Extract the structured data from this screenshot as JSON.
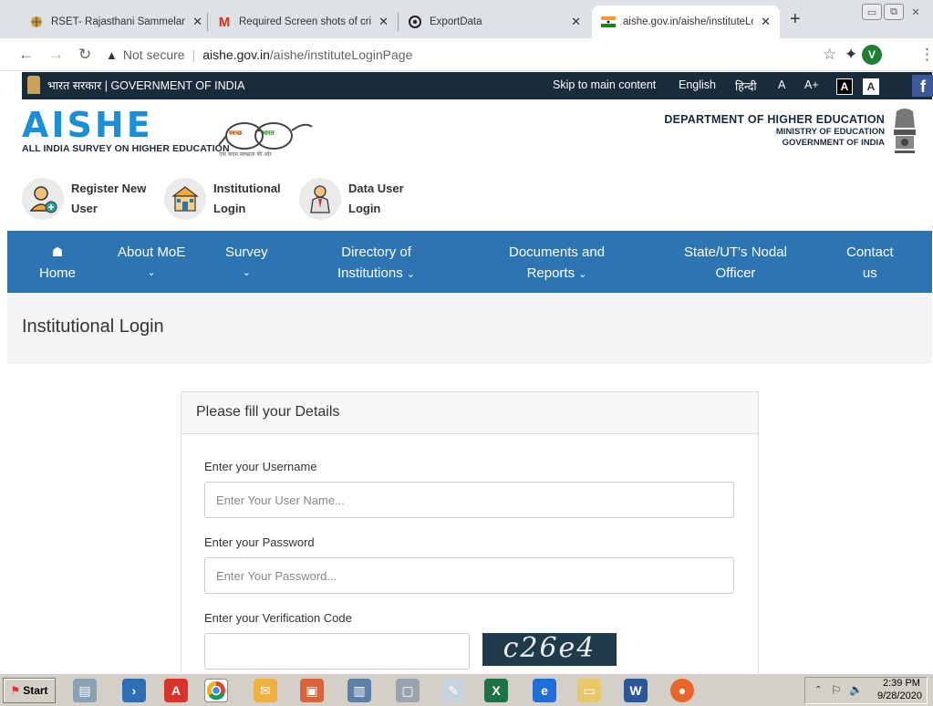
{
  "browser": {
    "tabs": [
      {
        "title": "RSET- Rajasthani Sammelan |",
        "icon": "rset-favicon",
        "active": false
      },
      {
        "title": "Required Screen shots of criti",
        "icon": "gmail-icon",
        "active": false
      },
      {
        "title": "ExportData",
        "icon": "export-icon",
        "active": false
      },
      {
        "title": "aishe.gov.in/aishe/instituteLo",
        "icon": "india-flag-icon",
        "active": true
      }
    ],
    "address": {
      "security": "Not secure",
      "host": "aishe.gov.in",
      "path": "/aishe/instituteLoginPage"
    },
    "profile_initial": "V"
  },
  "govbar": {
    "label": "भारत सरकार | GOVERNMENT OF INDIA",
    "skip": "Skip to main content",
    "english": "English",
    "hindi": "हिन्दी",
    "font_a": "A",
    "font_a_plus": "A+",
    "contrast_dark": "A",
    "contrast_light": "A",
    "facebook": "f"
  },
  "header": {
    "logo": "AISHE",
    "logo_sub": "ALL INDIA SURVEY ON HIGHER EDUCATION",
    "dept_line1": "DEPARTMENT OF HIGHER EDUCATION",
    "dept_line2": "MINISTRY OF EDUCATION",
    "dept_line3": "GOVERNMENT OF INDIA",
    "swachh_left": "स्वच्छ",
    "swachh_right": "भारत",
    "swachh_tagline": "एक कदम स्वच्छता की ओर"
  },
  "quick_links": [
    {
      "line1": "Register New",
      "line2": "User"
    },
    {
      "line1": "Institutional",
      "line2": "Login"
    },
    {
      "line1": "Data User",
      "line2": "Login"
    }
  ],
  "nav": {
    "home": "Home",
    "about": "About MoE",
    "survey": "Survey",
    "directory_1": "Directory of",
    "directory_2": "Institutions",
    "docs_1": "Documents and",
    "docs_2": "Reports",
    "nodal_1": "State/UT's Nodal",
    "nodal_2": "Officer",
    "contact_1": "Contact",
    "contact_2": "us"
  },
  "page": {
    "title": "Institutional Login",
    "card_title": "Please fill your Details",
    "username_label": "Enter your Username",
    "username_placeholder": "Enter Your User Name...",
    "password_label": "Enter your Password",
    "password_placeholder": "Enter Your Password...",
    "captcha_label": "Enter your Verification Code",
    "captcha_text": "c26e4"
  },
  "taskbar": {
    "start": "Start",
    "time": "2:39 PM",
    "date": "9/28/2020"
  },
  "colors": {
    "nav_blue": "#2d74b2",
    "govbar_dark": "#1a2b3c",
    "aishe_blue": "#1a8fd6",
    "captcha_bg": "#1f3a4a"
  }
}
